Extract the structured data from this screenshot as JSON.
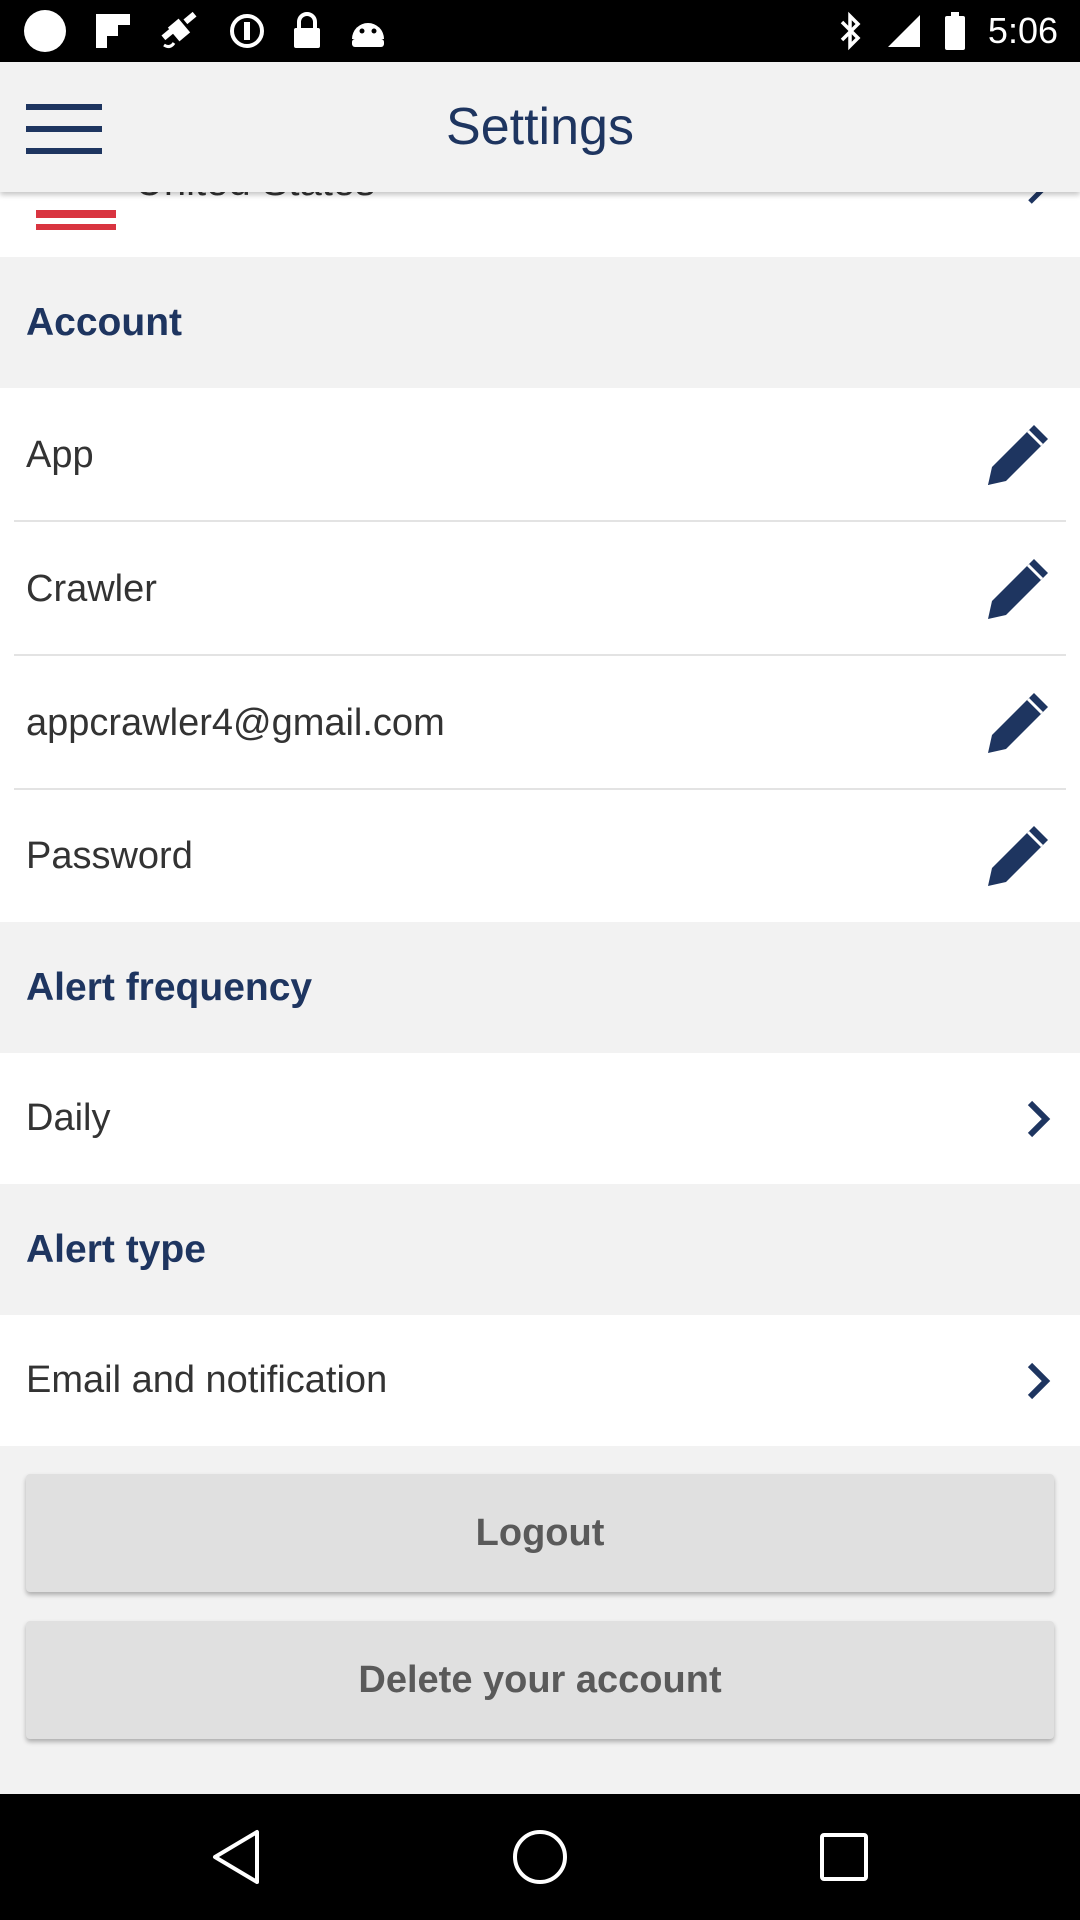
{
  "status_bar": {
    "time": "5:06",
    "left_icons": [
      "circle-icon",
      "flipboard-icon",
      "fake-gps-icon",
      "data-saver-icon",
      "lock-icon",
      "android-icon"
    ],
    "right_icons": [
      "bluetooth-icon",
      "signal-icon",
      "battery-icon"
    ]
  },
  "toolbar": {
    "title": "Settings",
    "menu_icon": "hamburger-menu-icon"
  },
  "country": {
    "label": "United States"
  },
  "sections": {
    "account": {
      "title": "Account",
      "items": [
        {
          "label": "App"
        },
        {
          "label": "Crawler"
        },
        {
          "label": "appcrawler4@gmail.com"
        },
        {
          "label": "Password"
        }
      ]
    },
    "alert_frequency": {
      "title": "Alert frequency",
      "value": "Daily"
    },
    "alert_type": {
      "title": "Alert type",
      "value": "Email and notification"
    }
  },
  "buttons": {
    "logout": "Logout",
    "delete_account": "Delete your account"
  },
  "colors": {
    "accent": "#1e3560",
    "section_bg": "#f2f2f2",
    "button_bg": "#e0e0e0",
    "button_text": "#5a5a5a"
  }
}
